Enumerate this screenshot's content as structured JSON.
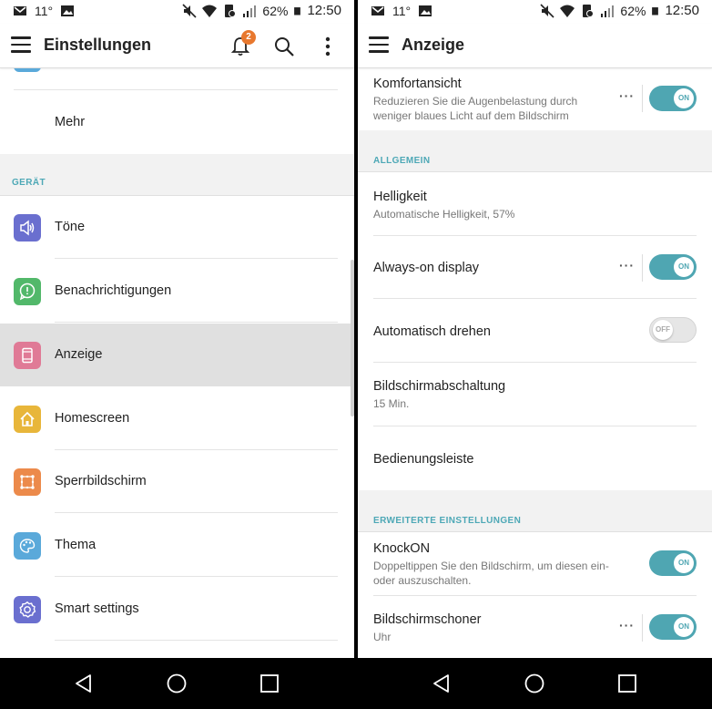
{
  "status_bar": {
    "temperature": "11°",
    "battery": "62%",
    "time": "12:50"
  },
  "left": {
    "title": "Einstellungen",
    "notification_count": "2",
    "items_top": [
      {
        "label": "Mehr"
      }
    ],
    "section_header": "GERÄT",
    "items": [
      {
        "label": "Töne",
        "icon": "speaker-icon",
        "color": "#6a6fcf"
      },
      {
        "label": "Benachrichtigungen",
        "icon": "chat-alert-icon",
        "color": "#52b86a"
      },
      {
        "label": "Anzeige",
        "icon": "display-icon",
        "color": "#e07a96"
      },
      {
        "label": "Homescreen",
        "icon": "home-icon",
        "color": "#e8b63a"
      },
      {
        "label": "Sperrbildschirm",
        "icon": "lock-pattern-icon",
        "color": "#ec8a4b"
      },
      {
        "label": "Thema",
        "icon": "palette-icon",
        "color": "#5aa9da"
      },
      {
        "label": "Smart settings",
        "icon": "smart-gear-icon",
        "color": "#6a6fcf"
      }
    ]
  },
  "right": {
    "title": "Anzeige",
    "komfort": {
      "title": "Komfortansicht",
      "subtitle": "Reduzieren Sie die Augenbelastung durch weniger blaues Licht auf dem Bildschirm",
      "toggle": "ON"
    },
    "section_general": "ALLGEMEIN",
    "brightness": {
      "title": "Helligkeit",
      "subtitle": "Automatische Helligkeit, 57%"
    },
    "aod": {
      "title": "Always-on display",
      "toggle": "ON"
    },
    "rotate": {
      "title": "Automatisch drehen",
      "toggle": "OFF"
    },
    "timeout": {
      "title": "Bildschirmabschaltung",
      "subtitle": "15 Min."
    },
    "navbar_item": {
      "title": "Bedienungsleiste"
    },
    "section_advanced": "ERWEITERTE EINSTELLUNGEN",
    "knockon": {
      "title": "KnockON",
      "subtitle": "Doppeltippen Sie den Bildschirm, um diesen ein- oder auszuschalten.",
      "toggle": "ON"
    },
    "screensaver": {
      "title": "Bildschirmschoner",
      "subtitle": "Uhr",
      "toggle": "ON"
    }
  },
  "colors": {
    "accent": "#4fa6b2",
    "selected_row": "#e0e0e0",
    "badge": "#e8782e"
  }
}
